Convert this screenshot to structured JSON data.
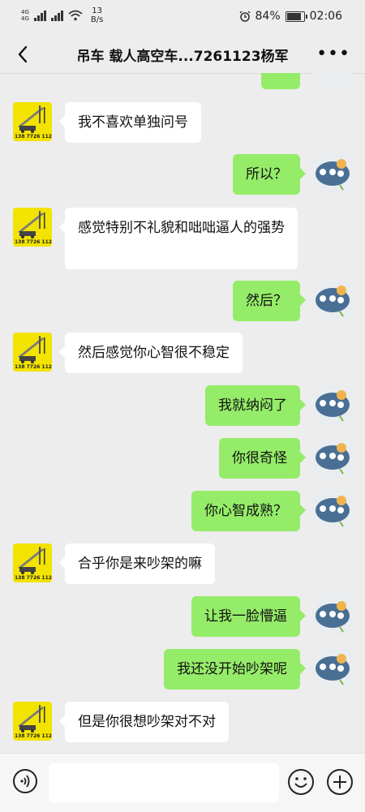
{
  "status_bar": {
    "net1": "4G",
    "net2": "4G",
    "speed_value": "13",
    "speed_unit": "B/s",
    "battery_percent": "84%",
    "time": "02:06",
    "alarm_icon": "alarm-icon",
    "battery_level": 0.84
  },
  "navbar": {
    "back_icon": "chevron-left-icon",
    "title": "吊车 载人高空车...7261123杨军",
    "more_icon": "more-icon"
  },
  "messages": [
    {
      "side": "left",
      "text": "我不喜欢单独问号"
    },
    {
      "side": "right",
      "text": "所以？"
    },
    {
      "side": "left",
      "text": "感觉特别不礼貌和咄咄逼人的强势"
    },
    {
      "side": "right",
      "text": "然后？"
    },
    {
      "side": "left",
      "text": "然后感觉你心智很不稳定"
    },
    {
      "side": "right",
      "text": "我就纳闷了"
    },
    {
      "side": "right",
      "text": "你很奇怪"
    },
    {
      "side": "right",
      "text": "你心智成熟？"
    },
    {
      "side": "left",
      "text": "合乎你是来吵架的嘛"
    },
    {
      "side": "right",
      "text": "让我一脸懵逼"
    },
    {
      "side": "right",
      "text": "我还没开始吵架呢"
    },
    {
      "side": "left",
      "text": "但是你很想吵架对不对"
    }
  ],
  "avatar_left_text": "138 7726 1123",
  "input_bar": {
    "voice_icon": "voice-icon",
    "emoji_icon": "emoji-icon",
    "plus_icon": "plus-icon",
    "placeholder": ""
  },
  "colors": {
    "background": "#ededed",
    "bubble_self": "#95ec69",
    "bubble_other": "#ffffff",
    "avatar_left": "#f2e300"
  }
}
